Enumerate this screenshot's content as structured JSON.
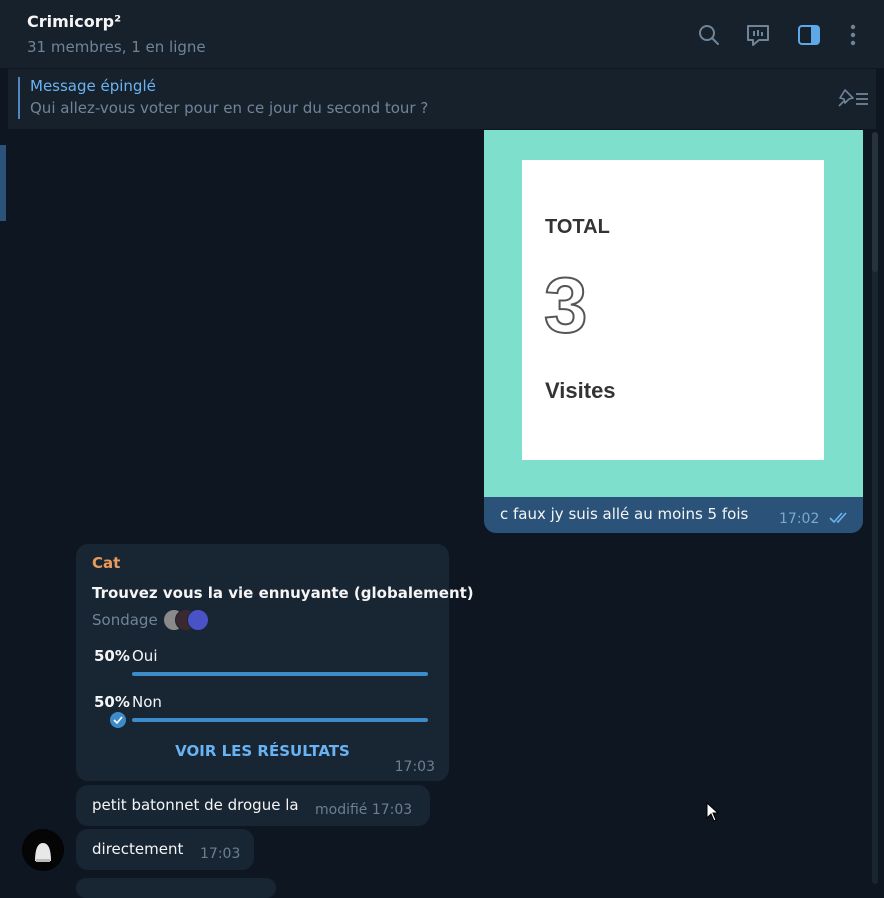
{
  "header": {
    "title": "Crimicorp²",
    "subtitle": "31 membres, 1 en ligne",
    "icons": [
      "search-icon",
      "live-chat-icon",
      "sidebar-toggle-icon",
      "more-icon"
    ]
  },
  "pinned": {
    "title": "Message épinglé",
    "text": "Qui allez-vous voter pour en ce jour du second tour ?",
    "icon": "pinned-list-icon"
  },
  "messages": {
    "media": {
      "image": {
        "total_label": "TOTAL",
        "number": "3",
        "visits_label": "Visites"
      },
      "caption": "c faux jy suis allé au moins 5 fois",
      "time": "17:02",
      "status_icon": "double-check-icon"
    },
    "poll": {
      "author": "Cat",
      "question": "Trouvez vous la vie ennuyante (globalement)",
      "type": "Sondage",
      "options": [
        {
          "percent": "50%",
          "label": "Oui",
          "fraction": 0.5
        },
        {
          "percent": "50%",
          "label": "Non",
          "fraction": 0.5,
          "voted": true
        }
      ],
      "results_label": "VOIR LES RÉSULTATS",
      "time": "17:03"
    },
    "text1": {
      "text": "petit batonnet de drogue la",
      "time": "modifié 17:03"
    },
    "text2": {
      "text": "directement",
      "time": "17:03"
    }
  },
  "colors": {
    "background": "#0e1621",
    "header": "#17212b",
    "outgoing_bubble": "#2b5278",
    "incoming_bubble": "#182533",
    "accent": "#6ab3f3",
    "author_name": "#e99b5a",
    "image_background": "#7edfcc"
  }
}
